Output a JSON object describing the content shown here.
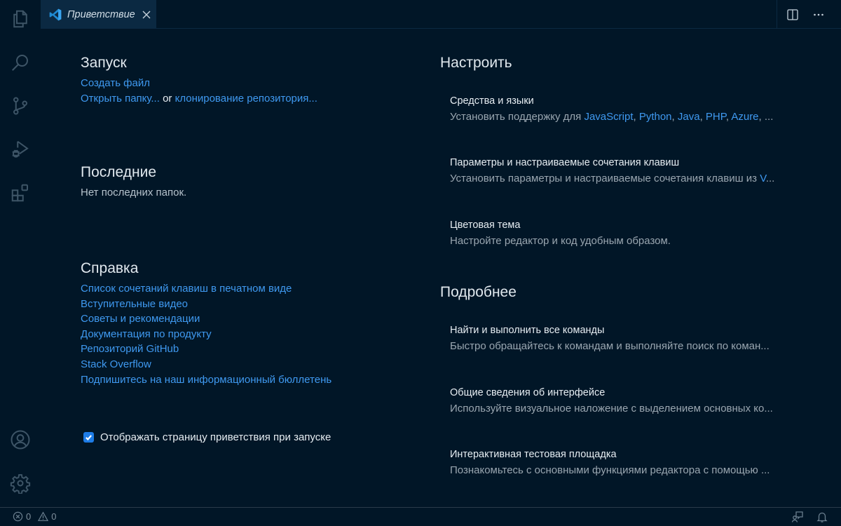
{
  "activity_bar": {
    "items": [
      {
        "name": "explorer",
        "icon": "files-icon"
      },
      {
        "name": "search",
        "icon": "search-icon"
      },
      {
        "name": "source-control",
        "icon": "source-control-icon"
      },
      {
        "name": "run-and-debug",
        "icon": "run-debug-icon"
      },
      {
        "name": "extensions",
        "icon": "extensions-icon"
      }
    ],
    "bottom_items": [
      {
        "name": "accounts",
        "icon": "account-icon"
      },
      {
        "name": "manage",
        "icon": "gear-icon"
      }
    ]
  },
  "tabs": [
    {
      "label": "Приветствие",
      "icon": "vscode-logo-icon",
      "active": true
    }
  ],
  "editor_actions": {
    "split": "split-editor-icon",
    "more": "more-actions-icon"
  },
  "welcome": {
    "start": {
      "heading": "Запуск",
      "new_file": "Создать файл",
      "open_folder": "Открыть папку...",
      "or": "or",
      "clone": "клонирование репозитория..."
    },
    "recent": {
      "heading": "Последние",
      "empty": "Нет последних папок."
    },
    "help": {
      "heading": "Справка",
      "links": [
        "Список сочетаний клавиш в печатном виде",
        "Вступительные видео",
        "Советы и рекомендации",
        "Документация по продукту",
        "Репозиторий GitHub",
        "Stack Overflow",
        "Подпишитесь на наш информационный бюллетень"
      ]
    },
    "show_on_startup": {
      "label": "Отображать страницу приветствия при запуске",
      "checked": true
    },
    "customize": {
      "heading": "Настроить",
      "items": [
        {
          "title": "Средства и языки",
          "desc_prefix": "Установить поддержку для ",
          "langs": [
            "JavaScript",
            "Python",
            "Java",
            "PHP",
            "Azure"
          ],
          "desc_suffix": ", ..."
        },
        {
          "title": "Параметры и настраиваемые сочетания клавиш",
          "desc_prefix": "Установить параметры и настраиваемые сочетания клавиш из ",
          "desc_link": "V",
          "desc_suffix": "..."
        },
        {
          "title": "Цветовая тема",
          "desc": "Настройте редактор и код удобным образом."
        }
      ]
    },
    "learn": {
      "heading": "Подробнее",
      "items": [
        {
          "title": "Найти и выполнить все команды",
          "desc": "Быстро обращайтесь к командам и выполняйте поиск по коман..."
        },
        {
          "title": "Общие сведения об интерфейсе",
          "desc": "Используйте визуальное наложение с выделением основных ко..."
        },
        {
          "title": "Интерактивная тестовая площадка",
          "desc": "Познакомьтесь с основными функциями редактора с помощью ..."
        }
      ]
    }
  },
  "statusbar": {
    "errors": "0",
    "warnings": "0",
    "feedback_icon": "feedback-icon",
    "notifications_icon": "bell-icon"
  },
  "colors": {
    "background": "#011627",
    "tab_active": "#0b2942",
    "link": "#3f99f0",
    "checkbox": "#1e7ce6"
  }
}
